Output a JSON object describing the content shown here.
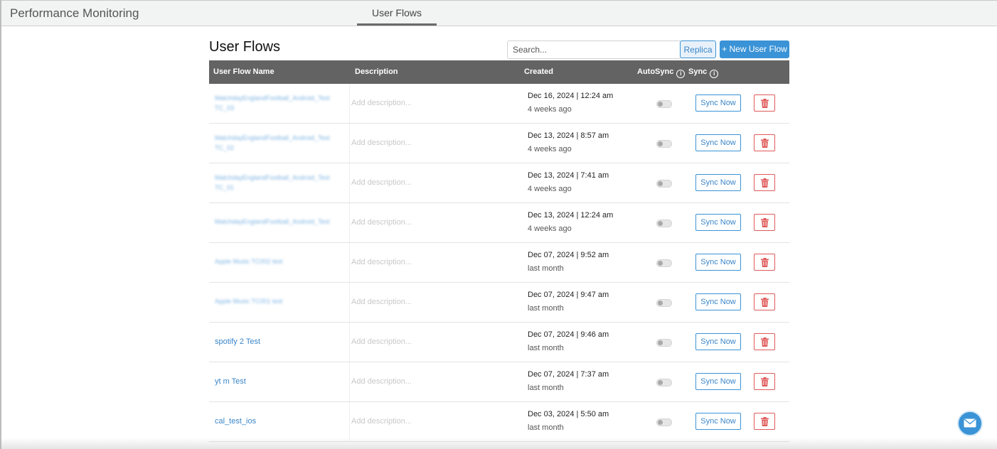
{
  "app": {
    "title": "Performance Monitoring"
  },
  "tabs": [
    {
      "label": "User Flows",
      "active": true
    }
  ],
  "page": {
    "title": "User Flows"
  },
  "search": {
    "placeholder": "Search..."
  },
  "buttons": {
    "replica": "Replica",
    "new_user_flow": "+ New User Flow"
  },
  "table": {
    "columns": {
      "name": "User Flow Name",
      "description": "Description",
      "created": "Created",
      "autosync": "AutoSync",
      "sync": "Sync"
    },
    "rows": [
      {
        "name_line1": "MatchdayEnglandFootball_Android_Test",
        "name_line2": "TC_03",
        "blurred": true,
        "description_placeholder": "Add description...",
        "created": "Dec 16, 2024 | 12:24 am",
        "relative": "4 weeks ago",
        "autosync": false,
        "sync_label": "Sync Now"
      },
      {
        "name_line1": "MatchdayEnglandFootball_Android_Test",
        "name_line2": "TC_02",
        "blurred": true,
        "description_placeholder": "Add description...",
        "created": "Dec 13, 2024 | 8:57 am",
        "relative": "4 weeks ago",
        "autosync": false,
        "sync_label": "Sync Now"
      },
      {
        "name_line1": "MatchdayEnglandFootball_Android_Test",
        "name_line2": "TC_01",
        "blurred": true,
        "description_placeholder": "Add description...",
        "created": "Dec 13, 2024 | 7:41 am",
        "relative": "4 weeks ago",
        "autosync": false,
        "sync_label": "Sync Now"
      },
      {
        "name_line1": "MatchdayEnglandFootball_Android_Test",
        "name_line2": "",
        "blurred": true,
        "description_placeholder": "Add description...",
        "created": "Dec 13, 2024 | 12:24 am",
        "relative": "4 weeks ago",
        "autosync": false,
        "sync_label": "Sync Now"
      },
      {
        "name_line1": "Apple Music TC002 test",
        "name_line2": "",
        "blurred": true,
        "description_placeholder": "Add description...",
        "created": "Dec 07, 2024 | 9:52 am",
        "relative": "last month",
        "autosync": false,
        "sync_label": "Sync Now"
      },
      {
        "name_line1": "Apple Music TC001 test",
        "name_line2": "",
        "blurred": true,
        "description_placeholder": "Add description...",
        "created": "Dec 07, 2024 | 9:47 am",
        "relative": "last month",
        "autosync": false,
        "sync_label": "Sync Now"
      },
      {
        "name_line1": "spotify 2 Test",
        "name_line2": "",
        "blurred": false,
        "description_placeholder": "Add description...",
        "created": "Dec 07, 2024 | 9:46 am",
        "relative": "last month",
        "autosync": false,
        "sync_label": "Sync Now"
      },
      {
        "name_line1": "yt m Test",
        "name_line2": "",
        "blurred": false,
        "description_placeholder": "Add description...",
        "created": "Dec 07, 2024 | 7:37 am",
        "relative": "last month",
        "autosync": false,
        "sync_label": "Sync Now"
      },
      {
        "name_line1": "cal_test_ios",
        "name_line2": "",
        "blurred": false,
        "description_placeholder": "Add description...",
        "created": "Dec 03, 2024 | 5:50 am",
        "relative": "last month",
        "autosync": false,
        "sync_label": "Sync Now"
      }
    ]
  },
  "colors": {
    "accent": "#3a93d6",
    "link": "#3a86c8",
    "header_bg": "#636363",
    "danger": "#e05a5a",
    "topbar_bg": "#f2f3f3"
  }
}
